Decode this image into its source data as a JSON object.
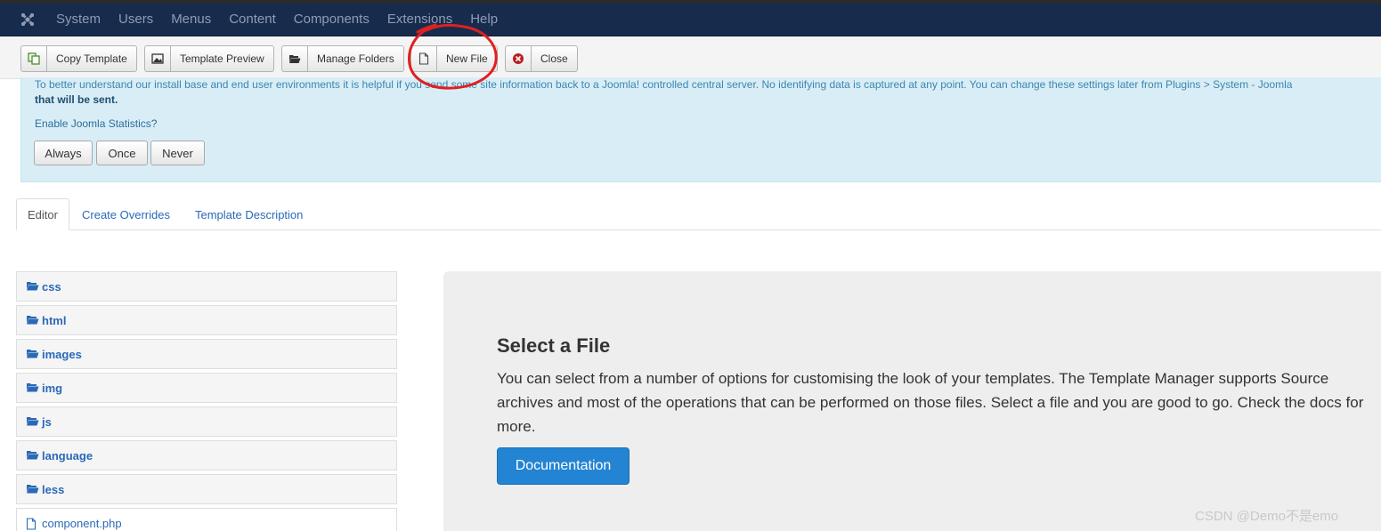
{
  "navbar": {
    "items": [
      "System",
      "Users",
      "Menus",
      "Content",
      "Components",
      "Extensions",
      "Help"
    ]
  },
  "toolbar": {
    "copy_template": "Copy Template",
    "template_preview": "Template Preview",
    "manage_folders": "Manage Folders",
    "new_file": "New File",
    "close": "Close"
  },
  "stats": {
    "line1": "To better understand our install base and end user environments it is helpful if you send some site information back to a Joomla! controlled central server. No identifying data is captured at any point. You can change these settings later from Plugins > System - Joomla",
    "line2": "that will be sent.",
    "question": "Enable Joomla Statistics?",
    "always": "Always",
    "once": "Once",
    "never": "Never"
  },
  "tabs": [
    "Editor",
    "Create Overrides",
    "Template Description"
  ],
  "tree": {
    "folders": [
      "css",
      "html",
      "images",
      "img",
      "js",
      "language",
      "less"
    ],
    "files": [
      "component.php"
    ]
  },
  "hero": {
    "title": "Select a File",
    "paragraph": "You can select from a number of options for customising the look of your templates. The Template Manager supports Source archives and most of the operations that can be performed on those files. Select a file and you are good to go. Check the docs for more.",
    "button": "Documentation"
  },
  "watermark": "CSDN @Demo不是emo",
  "colors": {
    "navbar": "#172b4d",
    "info_bg": "#d9edf7",
    "link": "#2a69b8",
    "primary": "#2384d3",
    "annotation": "#e02020"
  }
}
